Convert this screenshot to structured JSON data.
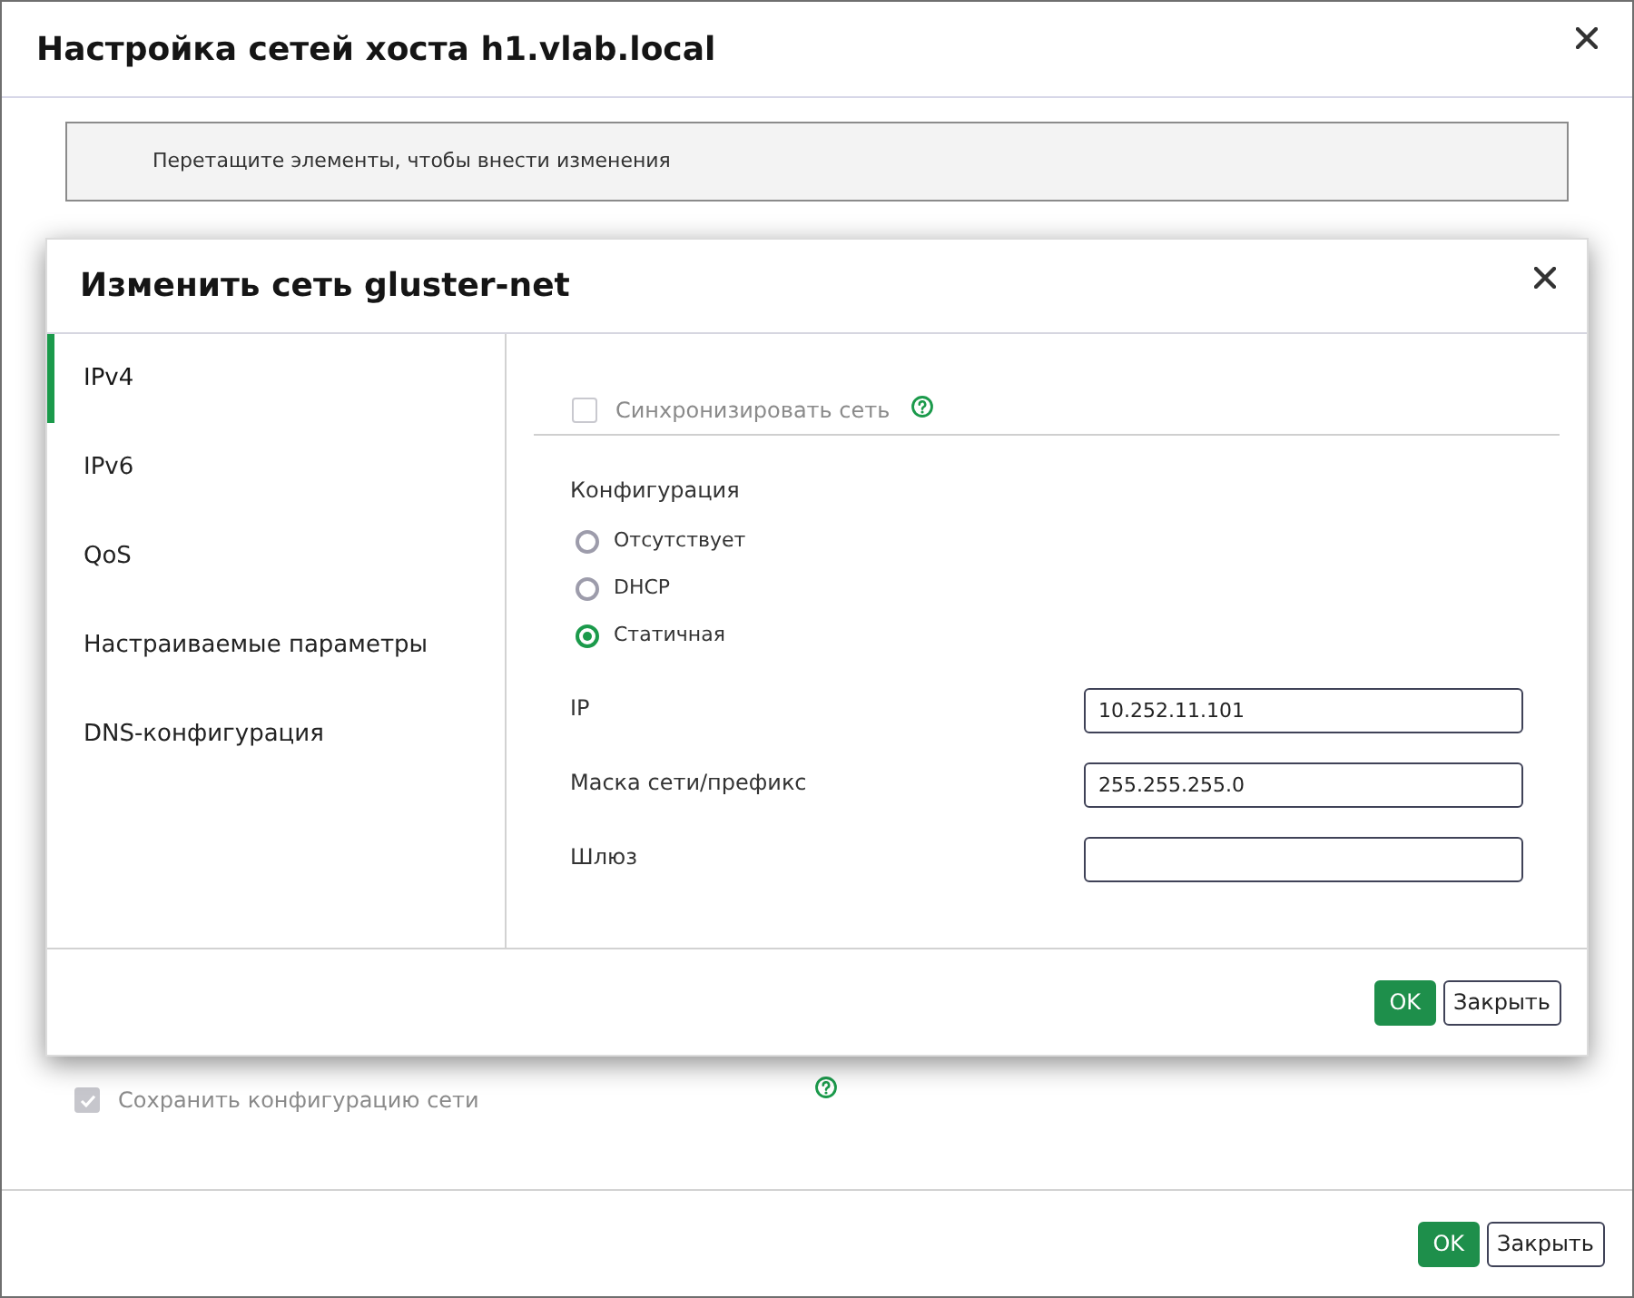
{
  "host_dialog": {
    "title": "Настройка сетей хоста h1.vlab.local",
    "hint": "Перетащите элементы, чтобы внести изменения",
    "save_config": {
      "label": "Сохранить конфигурацию сети",
      "checked": true,
      "disabled": true
    },
    "buttons": [
      {
        "label": "OK",
        "kind": "primary"
      },
      {
        "label": "Закрыть",
        "kind": "secondary"
      }
    ]
  },
  "network_dialog": {
    "title": "Изменить сеть gluster-net",
    "tabs": [
      {
        "label": "IPv4",
        "selected": true
      },
      {
        "label": "IPv6",
        "selected": false
      },
      {
        "label": "QoS",
        "selected": false
      },
      {
        "label": "Настраиваемые параметры",
        "selected": false
      },
      {
        "label": "DNS-конфигурация",
        "selected": false
      }
    ],
    "sync": {
      "label": "Синхронизировать сеть",
      "checked": false,
      "disabled": true
    },
    "config": {
      "label": "Конфигурация",
      "options": [
        {
          "label": "Отсутствует",
          "selected": false
        },
        {
          "label": "DHCP",
          "selected": false
        },
        {
          "label": "Статичная",
          "selected": true
        }
      ]
    },
    "fields": [
      {
        "label": "IP",
        "value": "10.252.11.101"
      },
      {
        "label": "Маска сети/префикс",
        "value": "255.255.255.0"
      },
      {
        "label": "Шлюз"
      }
    ],
    "buttons": [
      {
        "label": "OK",
        "kind": "primary"
      },
      {
        "label": "Закрыть",
        "kind": "secondary"
      }
    ]
  }
}
